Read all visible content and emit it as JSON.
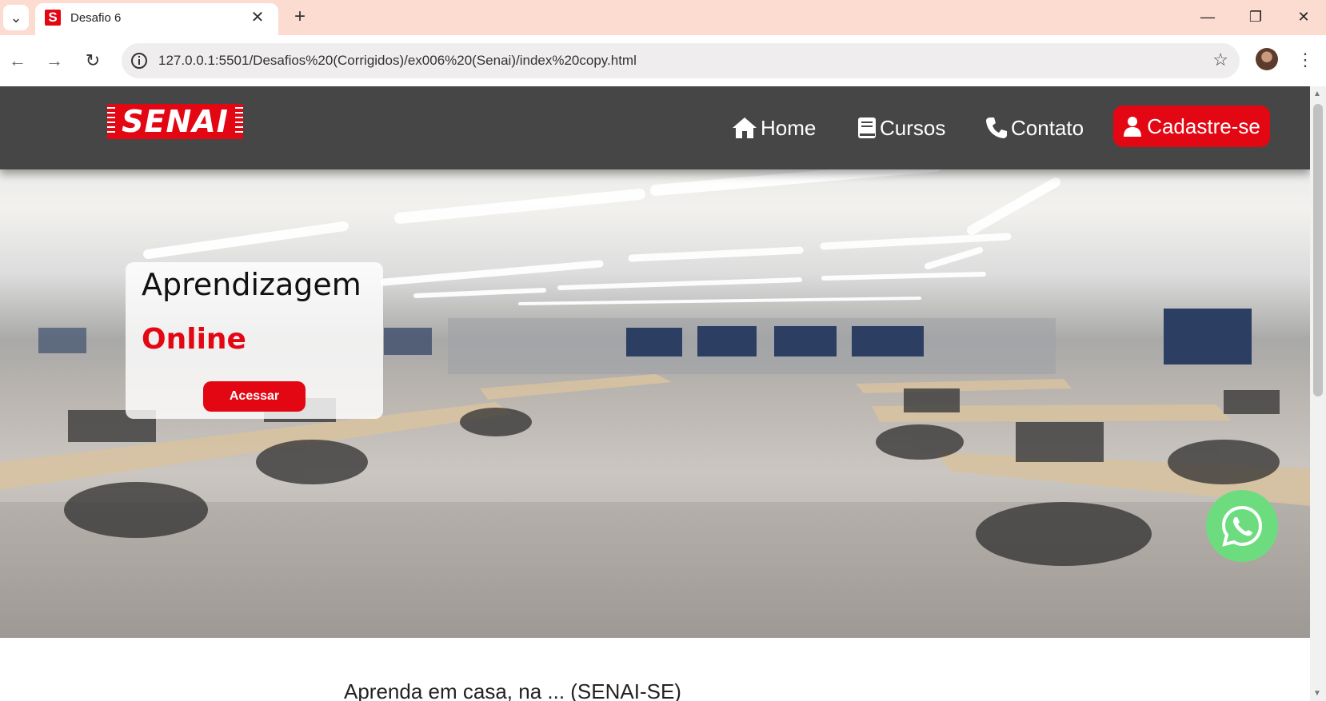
{
  "browser": {
    "tab_title": "Desafio 6",
    "favicon_letter": "S",
    "url": "127.0.0.1:5501/Desafios%20(Corrigidos)/ex006%20(Senai)/index%20copy.html",
    "tab_close": "✕",
    "new_tab": "+",
    "minimize": "—",
    "restore": "❐",
    "close": "✕",
    "back": "←",
    "forward": "→",
    "reload": "↻",
    "star": "☆",
    "menu": "⋮",
    "tab_menu": "⌄"
  },
  "header": {
    "logo_text": "SENAI",
    "nav": [
      {
        "label": "Home",
        "icon": "home-icon"
      },
      {
        "label": "Cursos",
        "icon": "book-icon"
      },
      {
        "label": "Contato",
        "icon": "phone-icon"
      }
    ],
    "cta_label": "Cadastre-se",
    "cta_icon": "user-icon"
  },
  "hero": {
    "heading": "Aprendizagem",
    "highlight": "Online",
    "button_label": "Acessar"
  },
  "floating": {
    "whatsapp_icon": "whatsapp-icon"
  },
  "below": {
    "partial_text": "Aprenda em casa, na ... (SENAI-SE)"
  },
  "colors": {
    "brand_red": "#e30613",
    "header_bg": "#464646",
    "whatsapp_green": "#6ddc7f",
    "tab_strip": "#fcdcd0"
  }
}
